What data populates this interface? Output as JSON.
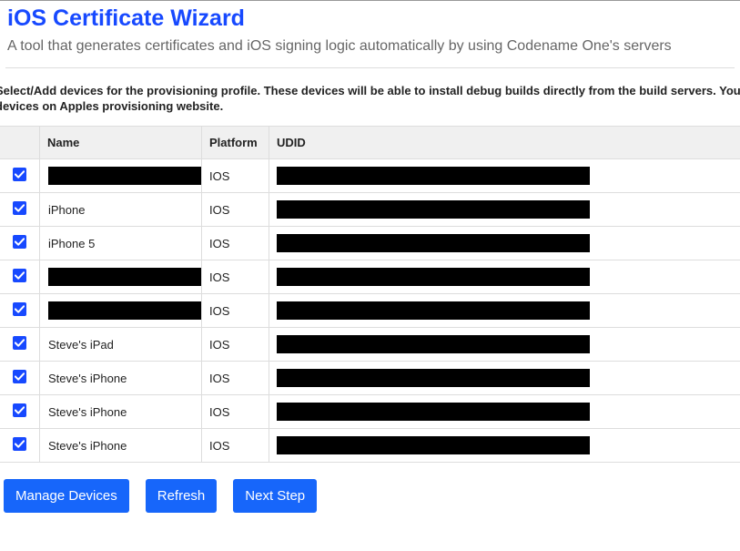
{
  "header": {
    "title": "iOS Certificate Wizard",
    "subtitle": "A tool that generates certificates and iOS signing logic automatically by using Codename One's servers"
  },
  "instructions": {
    "line1": "Select/Add devices for the provisioning profile. These devices will be able to install debug builds directly from the build servers. You must have a",
    "line2": "devices on Apples provisioning website."
  },
  "table": {
    "columns": {
      "checkbox": "",
      "name": "Name",
      "platform": "Platform",
      "udid": "UDID"
    },
    "rows": [
      {
        "checked": true,
        "name": "",
        "name_redacted": true,
        "platform": "IOS",
        "udid_redacted": true
      },
      {
        "checked": true,
        "name": "iPhone",
        "name_redacted": false,
        "platform": "IOS",
        "udid_redacted": true
      },
      {
        "checked": true,
        "name": "iPhone 5",
        "name_redacted": false,
        "platform": "IOS",
        "udid_redacted": true
      },
      {
        "checked": true,
        "name": "",
        "name_redacted": true,
        "platform": "IOS",
        "udid_redacted": true
      },
      {
        "checked": true,
        "name": "",
        "name_redacted": true,
        "platform": "IOS",
        "udid_redacted": true
      },
      {
        "checked": true,
        "name": "Steve's iPad",
        "name_redacted": false,
        "platform": "IOS",
        "udid_redacted": true
      },
      {
        "checked": true,
        "name": "Steve's iPhone",
        "name_redacted": false,
        "platform": "IOS",
        "udid_redacted": true
      },
      {
        "checked": true,
        "name": "Steve's iPhone",
        "name_redacted": false,
        "platform": "IOS",
        "udid_redacted": true
      },
      {
        "checked": true,
        "name": "Steve's iPhone",
        "name_redacted": false,
        "platform": "IOS",
        "udid_redacted": true
      }
    ]
  },
  "buttons": {
    "manage": "Manage Devices",
    "refresh": "Refresh",
    "next": "Next Step"
  }
}
